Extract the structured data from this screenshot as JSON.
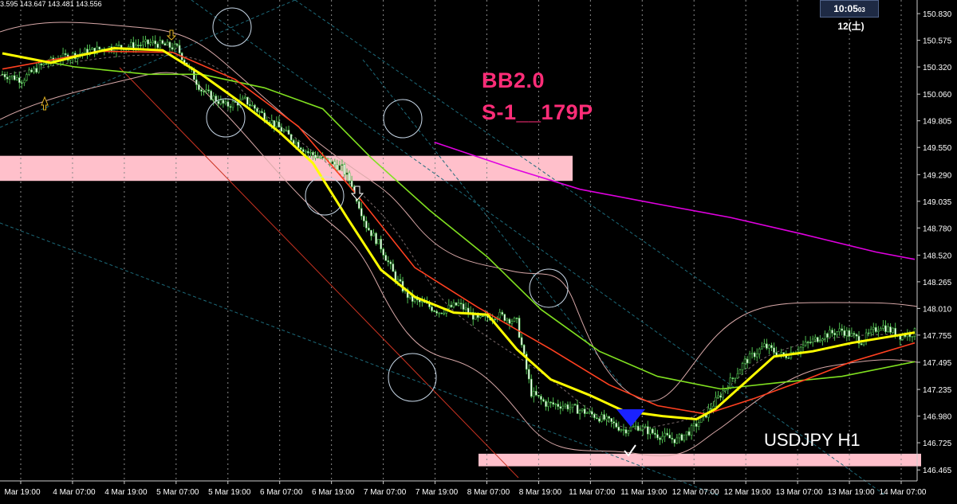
{
  "header": {
    "ohlc_text": "3.595 143.647 143.481 143.556",
    "clock_time": "10:05",
    "clock_seconds": "03",
    "clock_date": "12(土)"
  },
  "annotations": {
    "bb_label": "BB2.0",
    "signal_label": "S-1__179P",
    "symbol_label": "USDJPY H1"
  },
  "colors": {
    "background": "#000000",
    "candle": "#4fbf4f",
    "sma_fast": "#ffff00",
    "sma_mid": "#ff4020",
    "sma_slow": "#80e020",
    "sma_long": "#e000e0",
    "bands": "#d8a8a8",
    "zone": "#ffc0cb",
    "grid": "#8a8a8a"
  },
  "chart_data": {
    "type": "candlestick",
    "symbol": "USDJPY",
    "timeframe": "H1",
    "ylim": [
      146.36,
      150.93
    ],
    "y_ticks": [
      "150.830",
      "150.575",
      "150.320",
      "150.060",
      "149.805",
      "149.550",
      "149.290",
      "149.035",
      "148.780",
      "148.520",
      "148.265",
      "148.010",
      "147.755",
      "147.495",
      "147.235",
      "146.980",
      "146.725",
      "146.465"
    ],
    "x_ticks": [
      "Mar 19:00",
      "4 Mar 07:00",
      "4 Mar 19:00",
      "5 Mar 07:00",
      "5 Mar 19:00",
      "6 Mar 07:00",
      "6 Mar 19:00",
      "7 Mar 07:00",
      "7 Mar 19:00",
      "8 Mar 07:00",
      "8 Mar 19:00",
      "11 Mar 07:00",
      "11 Mar 19:00",
      "12 Mar 07:00",
      "12 Mar 19:00",
      "13 Mar 07:00",
      "13 Mar 19:00",
      "14 Mar 07:00"
    ],
    "zones": [
      {
        "from": 149.23,
        "to": 149.47
      },
      {
        "from": 146.5,
        "to": 146.62
      }
    ],
    "close_path": [
      [
        0,
        150.25
      ],
      [
        8,
        150.2
      ],
      [
        15,
        150.32
      ],
      [
        23,
        150.4
      ],
      [
        32,
        150.45
      ],
      [
        42,
        150.5
      ],
      [
        52,
        150.52
      ],
      [
        62,
        150.55
      ],
      [
        72,
        150.5
      ],
      [
        82,
        150.1
      ],
      [
        92,
        149.95
      ],
      [
        100,
        150.0
      ],
      [
        108,
        149.85
      ],
      [
        116,
        149.7
      ],
      [
        126,
        149.5
      ],
      [
        134,
        149.42
      ],
      [
        140,
        149.35
      ],
      [
        144,
        149.2
      ],
      [
        150,
        148.8
      ],
      [
        156,
        148.6
      ],
      [
        162,
        148.3
      ],
      [
        168,
        148.1
      ],
      [
        174,
        148.05
      ],
      [
        180,
        147.98
      ],
      [
        188,
        148.05
      ],
      [
        196,
        147.9
      ],
      [
        204,
        147.95
      ],
      [
        212,
        147.88
      ],
      [
        218,
        147.2
      ],
      [
        224,
        147.1
      ],
      [
        232,
        147.08
      ],
      [
        240,
        147.02
      ],
      [
        248,
        146.95
      ],
      [
        256,
        146.85
      ],
      [
        262,
        146.88
      ],
      [
        270,
        146.8
      ],
      [
        278,
        146.75
      ],
      [
        284,
        146.85
      ],
      [
        290,
        147.0
      ],
      [
        298,
        147.25
      ],
      [
        306,
        147.5
      ],
      [
        314,
        147.65
      ],
      [
        322,
        147.55
      ],
      [
        330,
        147.65
      ],
      [
        338,
        147.75
      ],
      [
        346,
        147.8
      ],
      [
        354,
        147.7
      ],
      [
        362,
        147.85
      ],
      [
        370,
        147.75
      ],
      [
        376,
        147.78
      ]
    ],
    "series": [
      {
        "name": "",
        "style": "sma_fast",
        "points": [
          [
            0,
            150.45
          ],
          [
            20,
            150.36
          ],
          [
            30,
            150.42
          ],
          [
            46,
            150.5
          ],
          [
            66,
            150.48
          ],
          [
            82,
            150.25
          ],
          [
            100,
            149.95
          ],
          [
            114,
            149.7
          ],
          [
            128,
            149.4
          ],
          [
            142,
            148.88
          ],
          [
            156,
            148.38
          ],
          [
            170,
            148.12
          ],
          [
            186,
            147.97
          ],
          [
            200,
            147.95
          ],
          [
            212,
            147.62
          ],
          [
            226,
            147.33
          ],
          [
            242,
            147.18
          ],
          [
            256,
            147.03
          ],
          [
            272,
            146.98
          ],
          [
            286,
            146.95
          ],
          [
            294,
            147.05
          ],
          [
            306,
            147.3
          ],
          [
            318,
            147.55
          ],
          [
            334,
            147.6
          ],
          [
            350,
            147.68
          ],
          [
            376,
            147.78
          ]
        ]
      },
      {
        "name": "",
        "style": "sma_mid",
        "points": [
          [
            0,
            150.3
          ],
          [
            40,
            150.47
          ],
          [
            70,
            150.46
          ],
          [
            96,
            150.2
          ],
          [
            122,
            149.75
          ],
          [
            146,
            149.1
          ],
          [
            170,
            148.4
          ],
          [
            196,
            148.02
          ],
          [
            226,
            147.62
          ],
          [
            250,
            147.28
          ],
          [
            270,
            147.08
          ],
          [
            290,
            147.0
          ],
          [
            310,
            147.15
          ],
          [
            330,
            147.32
          ],
          [
            350,
            147.5
          ],
          [
            376,
            147.68
          ]
        ]
      },
      {
        "name": "",
        "style": "sma_slow",
        "points": [
          [
            0,
            150.45
          ],
          [
            30,
            150.32
          ],
          [
            60,
            150.25
          ],
          [
            82,
            150.25
          ],
          [
            108,
            150.12
          ],
          [
            132,
            149.92
          ],
          [
            152,
            149.45
          ],
          [
            176,
            148.95
          ],
          [
            200,
            148.5
          ],
          [
            222,
            148.0
          ],
          [
            246,
            147.6
          ],
          [
            270,
            147.36
          ],
          [
            296,
            147.24
          ],
          [
            320,
            147.3
          ],
          [
            346,
            147.36
          ],
          [
            376,
            147.5
          ]
        ]
      },
      {
        "name": "",
        "style": "sma_long",
        "points": [
          [
            178,
            149.6
          ],
          [
            210,
            149.35
          ],
          [
            238,
            149.15
          ],
          [
            272,
            149.0
          ],
          [
            300,
            148.88
          ],
          [
            330,
            148.72
          ],
          [
            360,
            148.55
          ],
          [
            376,
            148.48
          ]
        ]
      }
    ]
  }
}
